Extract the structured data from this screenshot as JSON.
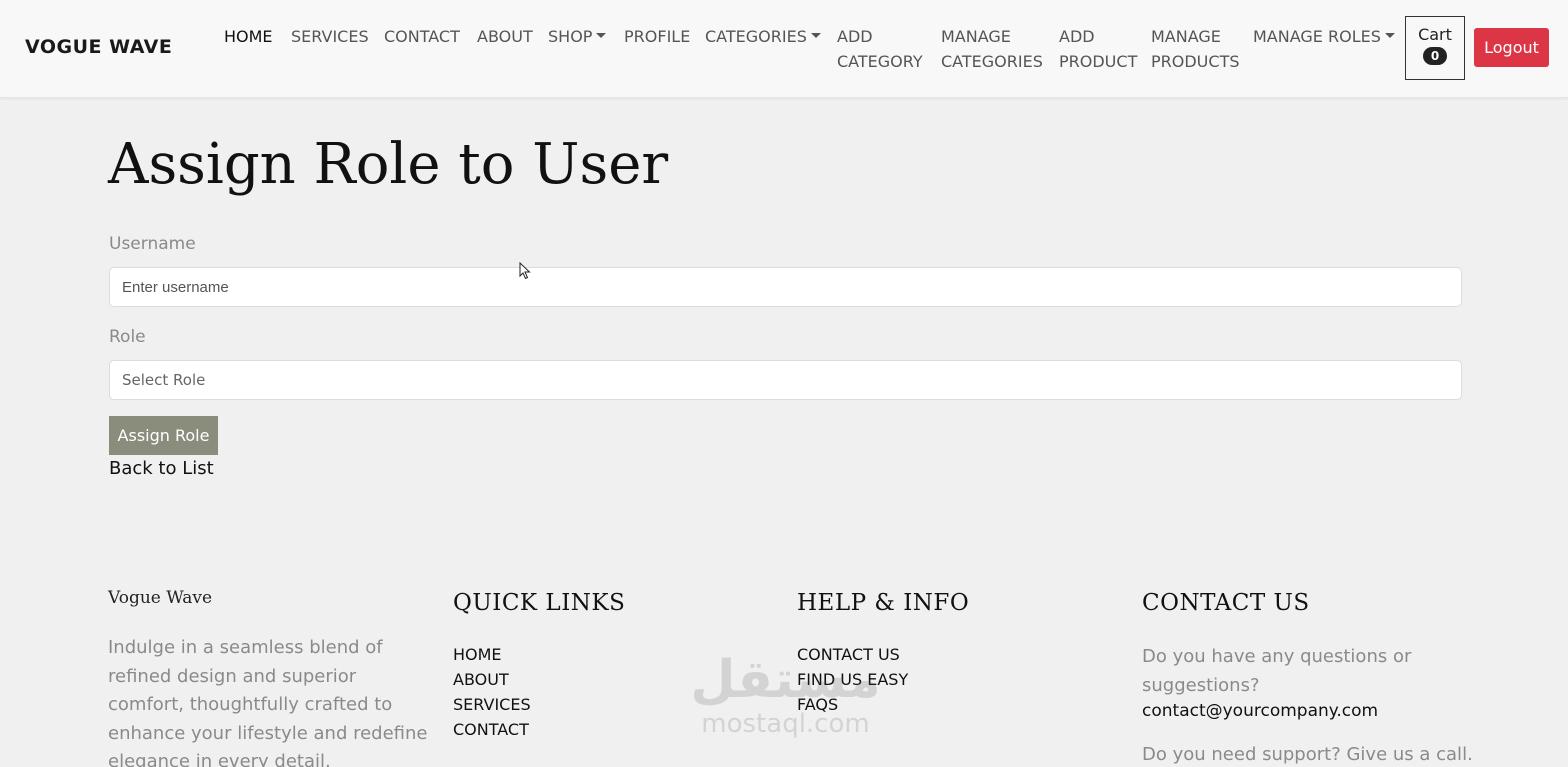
{
  "header": {
    "brand": "VOGUE WAVE",
    "nav": [
      {
        "label": "HOME"
      },
      {
        "label": "SERVICES"
      },
      {
        "label": "CONTACT"
      },
      {
        "label": "ABOUT"
      },
      {
        "label": "SHOP"
      },
      {
        "label": "PROFILE"
      },
      {
        "label": "CATEGORIES"
      },
      {
        "label": "ADD\nCATEGORY"
      },
      {
        "label": "MANAGE\nCATEGORIES"
      },
      {
        "label": "ADD\nPRODUCT"
      },
      {
        "label": "MANAGE\nPRODUCTS"
      },
      {
        "label": "MANAGE ROLES"
      }
    ],
    "cart_label": "Cart",
    "cart_count": "0",
    "logout_label": "Logout"
  },
  "form": {
    "title": "Assign Role to User",
    "username_label": "Username",
    "username_placeholder": "Enter username",
    "role_label": "Role",
    "role_selected": "Select Role",
    "submit_label": "Assign Role",
    "back_label": "Back to List"
  },
  "footer": {
    "brand": "Vogue Wave",
    "description": "Indulge in a seamless blend of refined design and superior comfort, thoughtfully crafted to enhance your lifestyle and redefine elegance in every detail.",
    "quick_links": {
      "heading": "QUICK LINKS",
      "items": [
        "HOME",
        "ABOUT",
        "SERVICES",
        "CONTACT"
      ]
    },
    "help": {
      "heading": "HELP & INFO",
      "items": [
        "CONTACT US",
        "FIND US EASY",
        "FAQS"
      ]
    },
    "contact": {
      "heading": "CONTACT US",
      "question": "Do you have any questions or suggestions?",
      "email": "contact@yourcompany.com",
      "support": "Do you need support? Give us a call."
    }
  },
  "watermark": {
    "arabic": "مستقل",
    "latin": "mostaql.com"
  },
  "colors": {
    "logout": "#dc3545",
    "assign_button": "#8a8c7c",
    "background": "#f0f0f0"
  }
}
